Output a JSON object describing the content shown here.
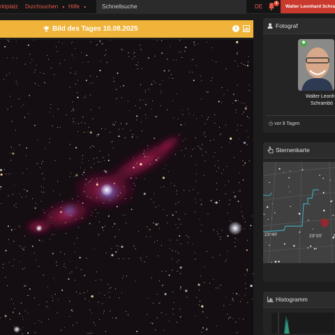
{
  "topbar": {
    "nav_marketplace": "rktplatz",
    "nav_browse": "Durchsuchen",
    "nav_help": "Hilfe",
    "search_placeholder": "Schnellsuche",
    "language": "DE",
    "notification_count": "4",
    "user_name": "Walter Leonhard Schramböck"
  },
  "iotd": {
    "title": "Bild des Tages 10.08.2025",
    "accent_color": "#f0b43a"
  },
  "photographer_panel": {
    "title": "Fotograf",
    "name_line1": "Walter Leonh",
    "name_line2": "Schrambö",
    "published_ago": "vor 8 Tagen"
  },
  "skymap_panel": {
    "title": "Sternenkarte",
    "labels": [
      "23°40'",
      "23°20'",
      "2"
    ]
  },
  "histogram_panel": {
    "title": "Histogramm"
  }
}
